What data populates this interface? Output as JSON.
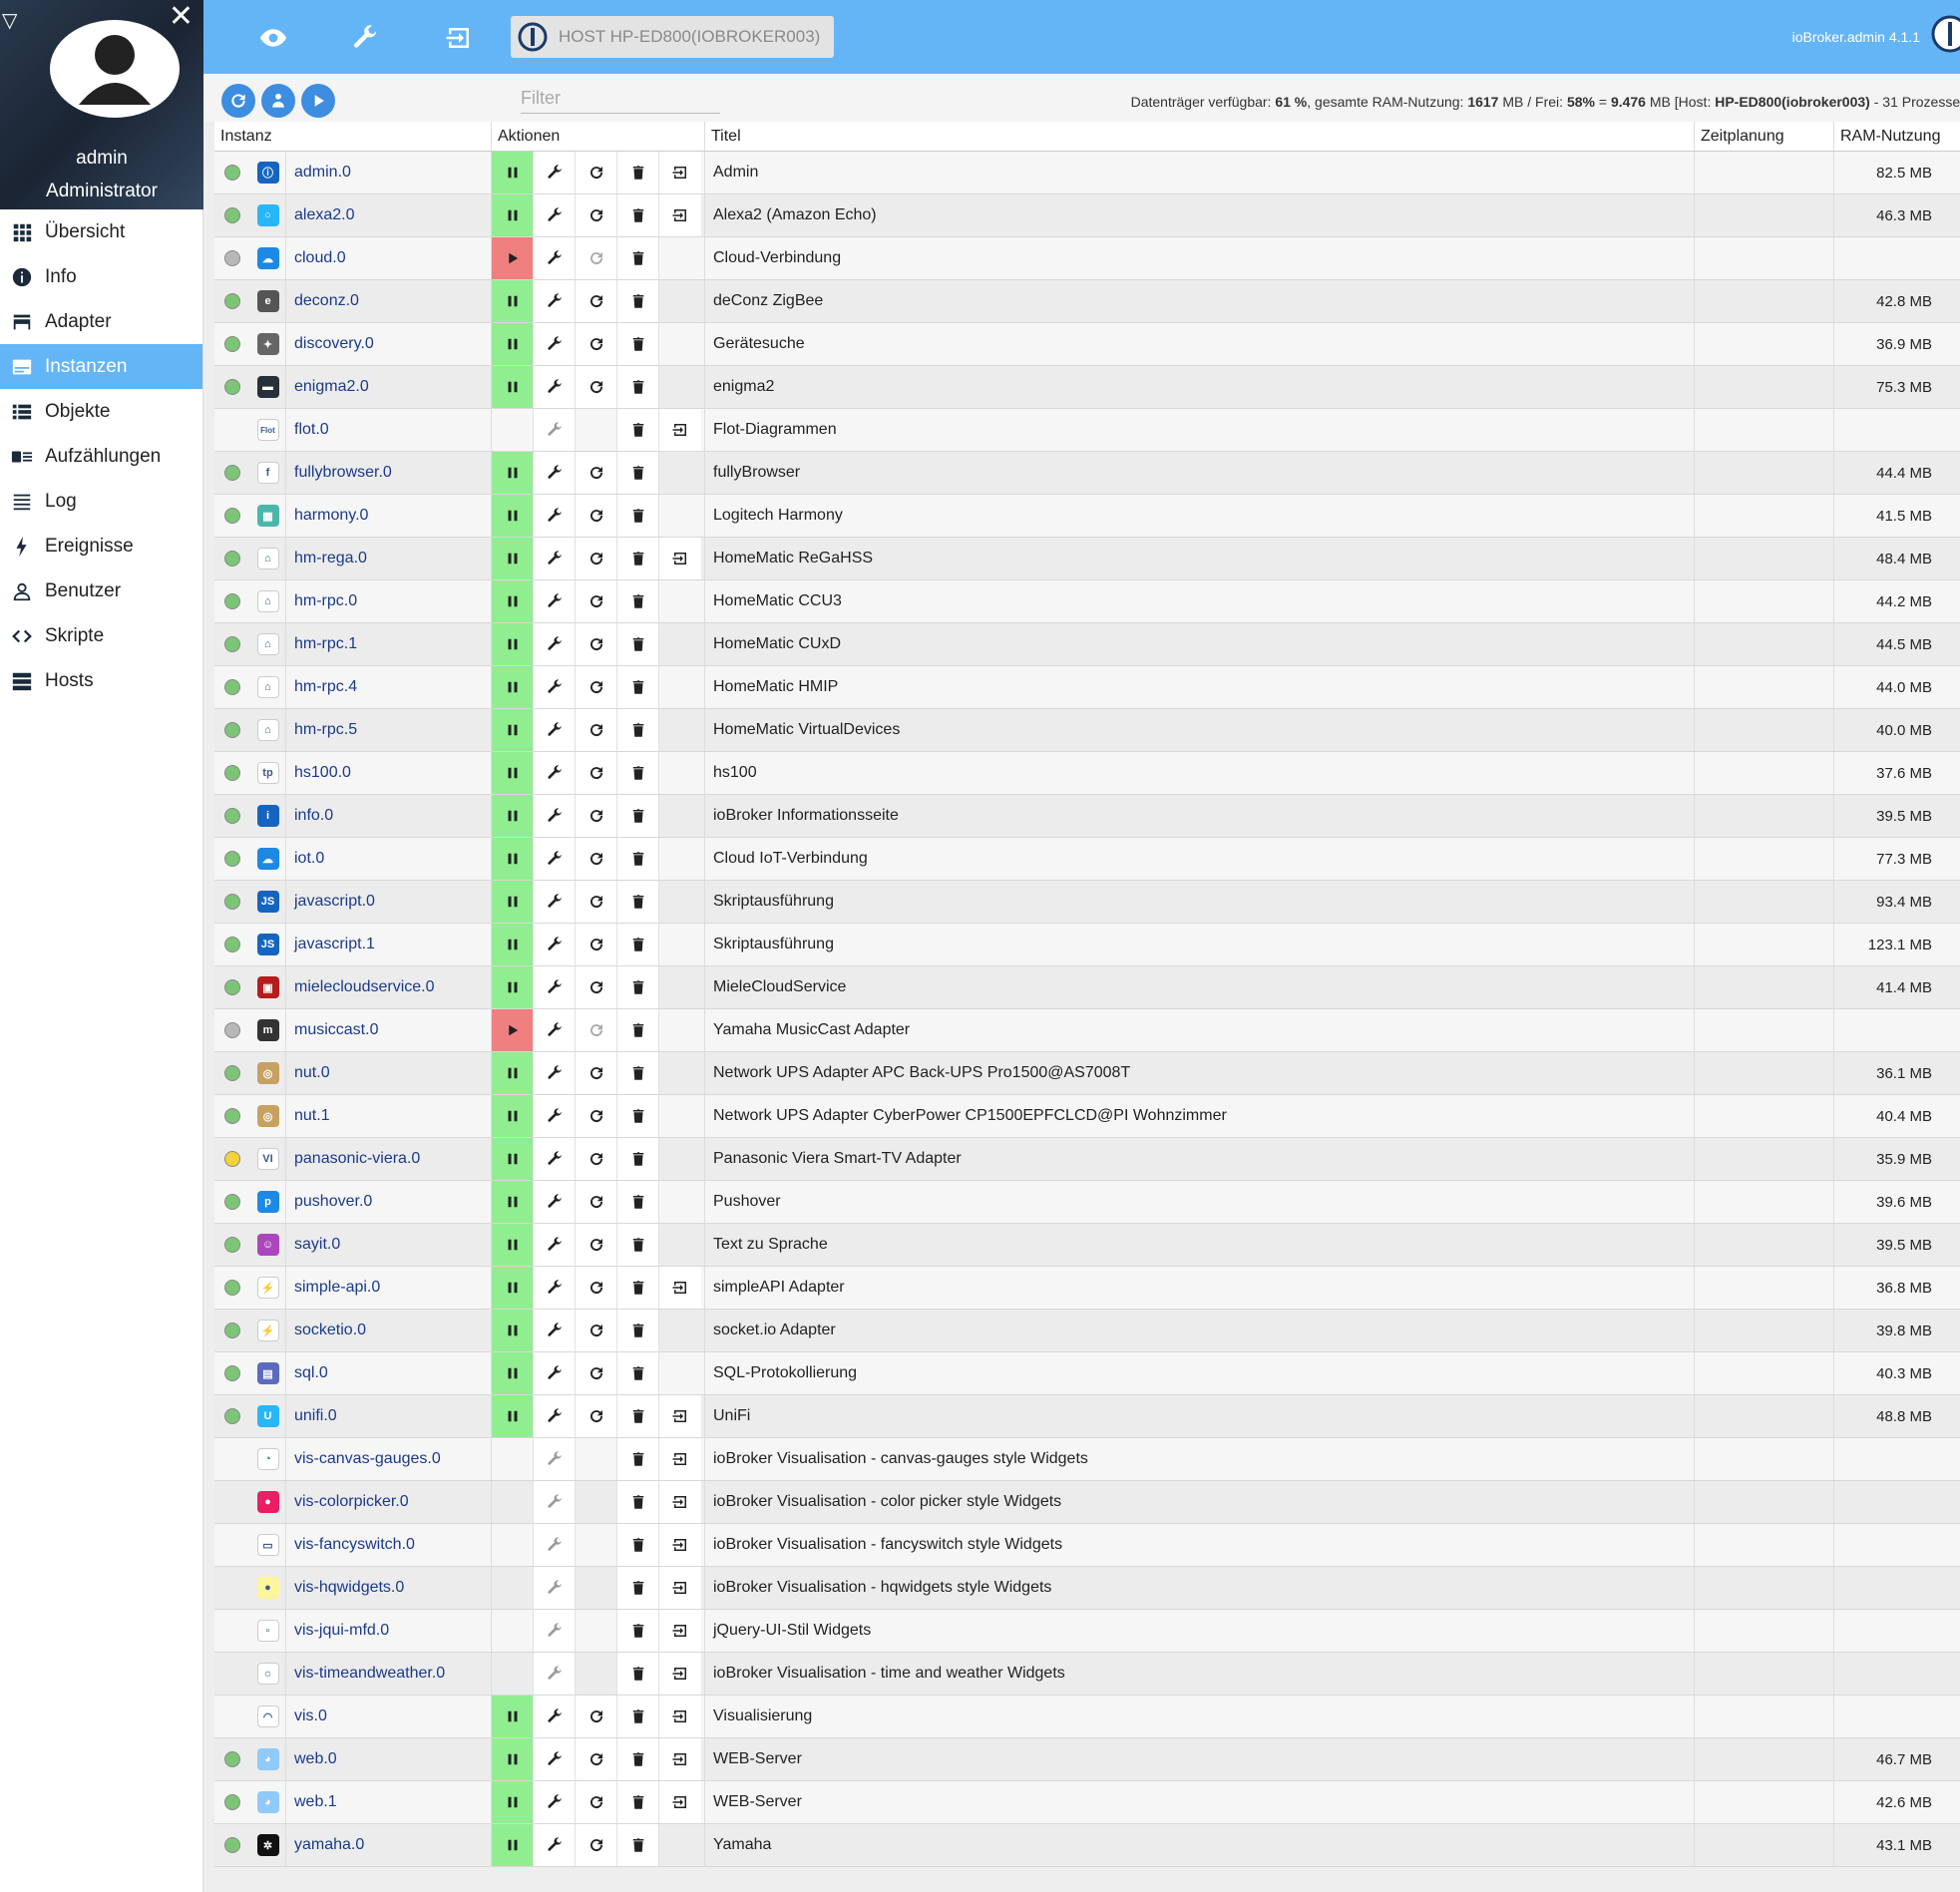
{
  "sidebar": {
    "username": "admin",
    "role": "Administrator",
    "items": [
      {
        "label": "Übersicht",
        "icon": "grid-icon"
      },
      {
        "label": "Info",
        "icon": "info-icon"
      },
      {
        "label": "Adapter",
        "icon": "store-icon"
      },
      {
        "label": "Instanzen",
        "icon": "instances-icon"
      },
      {
        "label": "Objekte",
        "icon": "list-icon"
      },
      {
        "label": "Aufzählungen",
        "icon": "enum-icon"
      },
      {
        "label": "Log",
        "icon": "log-icon"
      },
      {
        "label": "Ereignisse",
        "icon": "bolt-icon"
      },
      {
        "label": "Benutzer",
        "icon": "user-icon"
      },
      {
        "label": "Skripte",
        "icon": "code-icon"
      },
      {
        "label": "Hosts",
        "icon": "hosts-icon"
      }
    ],
    "active_item": "Instanzen"
  },
  "topbar": {
    "host": "HOST HP-ED800(IOBROKER003)",
    "version": "ioBroker.admin 4.1.1",
    "accent": "#64b5f6"
  },
  "toolbar": {
    "filter_placeholder": "Filter",
    "sysinfo_prefix": "Datenträger verfügbar: ",
    "disk_free": "61 %",
    "sysinfo_ram_label": ", gesamte RAM-Nutzung: ",
    "ram_total": "1617",
    "sysinfo_free_label": " MB / Frei: ",
    "ram_free_pct": "58%",
    "sysinfo_eq": " = ",
    "ram_free_mb": "9.476",
    "sysinfo_host_label": " MB [Host: ",
    "host_name": "HP-ED800(iobroker003)",
    "sysinfo_suffix": " - 31 Prozesse]"
  },
  "table": {
    "headers": {
      "instance": "Instanz",
      "actions": "Aktionen",
      "title": "Titel",
      "schedule": "Zeitplanung",
      "ram": "RAM-Nutzung"
    },
    "rows": [
      {
        "name": "admin.0",
        "title": "Admin",
        "ram": "82.5 MB",
        "status": "green",
        "state": "run",
        "link": true,
        "icon": "admin-icon",
        "icolor": "#1565c0",
        "glyph": "ⓘ"
      },
      {
        "name": "alexa2.0",
        "title": "Alexa2 (Amazon Echo)",
        "ram": "46.3 MB",
        "status": "green",
        "state": "run",
        "link": true,
        "icon": "alexa-icon",
        "icolor": "#29b6f6",
        "glyph": "○"
      },
      {
        "name": "cloud.0",
        "title": "Cloud-Verbindung",
        "ram": "",
        "status": "grey",
        "state": "stopped",
        "link": false,
        "icon": "cloud-icon",
        "icolor": "#1e88e5",
        "glyph": "☁"
      },
      {
        "name": "deconz.0",
        "title": "deConz ZigBee",
        "ram": "42.8 MB",
        "status": "green",
        "state": "run",
        "link": false,
        "icon": "deconz-icon",
        "icolor": "#555555",
        "glyph": "e"
      },
      {
        "name": "discovery.0",
        "title": "Gerätesuche",
        "ram": "36.9 MB",
        "status": "green",
        "state": "run",
        "link": false,
        "icon": "discovery-icon",
        "icolor": "#666666",
        "glyph": "✦"
      },
      {
        "name": "enigma2.0",
        "title": "enigma2",
        "ram": "75.3 MB",
        "status": "green",
        "state": "run",
        "link": false,
        "icon": "enigma-icon",
        "icolor": "#263238",
        "glyph": "▬"
      },
      {
        "name": "flot.0",
        "title": "Flot-Diagrammen",
        "ram": "",
        "status": "none",
        "state": "none",
        "link": true,
        "icon": "flot-icon",
        "icolor": "#ffffff",
        "glyph": "Flot"
      },
      {
        "name": "fullybrowser.0",
        "title": "fullyBrowser",
        "ram": "44.4 MB",
        "status": "green",
        "state": "run",
        "link": false,
        "icon": "fully-icon",
        "icolor": "#ffffff",
        "glyph": "f"
      },
      {
        "name": "harmony.0",
        "title": "Logitech Harmony",
        "ram": "41.5 MB",
        "status": "green",
        "state": "run",
        "link": false,
        "icon": "harmony-icon",
        "icolor": "#4db6ac",
        "glyph": "▦"
      },
      {
        "name": "hm-rega.0",
        "title": "HomeMatic ReGaHSS",
        "ram": "48.4 MB",
        "status": "green",
        "state": "run",
        "link": true,
        "icon": "homematic-icon",
        "icolor": "#ffffff",
        "glyph": "⌂"
      },
      {
        "name": "hm-rpc.0",
        "title": "HomeMatic CCU3",
        "ram": "44.2 MB",
        "status": "green",
        "state": "run",
        "link": false,
        "icon": "homematic-icon",
        "icolor": "#ffffff",
        "glyph": "⌂"
      },
      {
        "name": "hm-rpc.1",
        "title": "HomeMatic CUxD",
        "ram": "44.5 MB",
        "status": "green",
        "state": "run",
        "link": false,
        "icon": "homematic-icon",
        "icolor": "#ffffff",
        "glyph": "⌂"
      },
      {
        "name": "hm-rpc.4",
        "title": "HomeMatic HMIP",
        "ram": "44.0 MB",
        "status": "green",
        "state": "run",
        "link": false,
        "icon": "homematic-icon",
        "icolor": "#ffffff",
        "glyph": "⌂"
      },
      {
        "name": "hm-rpc.5",
        "title": "HomeMatic VirtualDevices",
        "ram": "40.0 MB",
        "status": "green",
        "state": "run",
        "link": false,
        "icon": "homematic-icon",
        "icolor": "#ffffff",
        "glyph": "⌂"
      },
      {
        "name": "hs100.0",
        "title": "hs100",
        "ram": "37.6 MB",
        "status": "green",
        "state": "run",
        "link": false,
        "icon": "tplink-icon",
        "icolor": "#ffffff",
        "glyph": "tp"
      },
      {
        "name": "info.0",
        "title": "ioBroker Informationsseite",
        "ram": "39.5 MB",
        "status": "green",
        "state": "run",
        "link": false,
        "icon": "info-adapter-icon",
        "icolor": "#1565c0",
        "glyph": "i"
      },
      {
        "name": "iot.0",
        "title": "Cloud IoT-Verbindung",
        "ram": "77.3 MB",
        "status": "green",
        "state": "run",
        "link": false,
        "icon": "iot-icon",
        "icolor": "#1e88e5",
        "glyph": "☁"
      },
      {
        "name": "javascript.0",
        "title": "Skriptausführung",
        "ram": "93.4 MB",
        "status": "green",
        "state": "run",
        "link": false,
        "icon": "js-icon",
        "icolor": "#1565c0",
        "glyph": "JS"
      },
      {
        "name": "javascript.1",
        "title": "Skriptausführung",
        "ram": "123.1 MB",
        "status": "green",
        "state": "run",
        "link": false,
        "icon": "js-icon",
        "icolor": "#1565c0",
        "glyph": "JS"
      },
      {
        "name": "mielecloudservice.0",
        "title": "MieleCloudService",
        "ram": "41.4 MB",
        "status": "green",
        "state": "run",
        "link": false,
        "icon": "miele-icon",
        "icolor": "#b71c1c",
        "glyph": "▣"
      },
      {
        "name": "musiccast.0",
        "title": "Yamaha MusicCast Adapter",
        "ram": "",
        "status": "grey",
        "state": "stopped",
        "link": false,
        "icon": "musiccast-icon",
        "icolor": "#333333",
        "glyph": "m"
      },
      {
        "name": "nut.0",
        "title": "Network UPS Adapter APC Back-UPS Pro1500@AS7008T",
        "ram": "36.1 MB",
        "status": "green",
        "state": "run",
        "link": false,
        "icon": "nut-icon",
        "icolor": "#c8a060",
        "glyph": "◎"
      },
      {
        "name": "nut.1",
        "title": "Network UPS Adapter CyberPower CP1500EPFCLCD@PI Wohnzimmer",
        "ram": "40.4 MB",
        "status": "green",
        "state": "run",
        "link": false,
        "icon": "nut-icon",
        "icolor": "#c8a060",
        "glyph": "◎"
      },
      {
        "name": "panasonic-viera.0",
        "title": "Panasonic Viera Smart-TV Adapter",
        "ram": "35.9 MB",
        "status": "yellow",
        "state": "run",
        "link": false,
        "icon": "viera-icon",
        "icolor": "#ffffff",
        "glyph": "VI"
      },
      {
        "name": "pushover.0",
        "title": "Pushover",
        "ram": "39.6 MB",
        "status": "green",
        "state": "run",
        "link": false,
        "icon": "pushover-icon",
        "icolor": "#1e88e5",
        "glyph": "p"
      },
      {
        "name": "sayit.0",
        "title": "Text zu Sprache",
        "ram": "39.5 MB",
        "status": "green",
        "state": "run",
        "link": false,
        "icon": "sayit-icon",
        "icolor": "#ab47bc",
        "glyph": "☺"
      },
      {
        "name": "simple-api.0",
        "title": "simpleAPI Adapter",
        "ram": "36.8 MB",
        "status": "green",
        "state": "run",
        "link": true,
        "icon": "simpleapi-icon",
        "icolor": "#ffffff",
        "glyph": "⚡"
      },
      {
        "name": "socketio.0",
        "title": "socket.io Adapter",
        "ram": "39.8 MB",
        "status": "green",
        "state": "run",
        "link": false,
        "icon": "socketio-icon",
        "icolor": "#ffffff",
        "glyph": "⚡"
      },
      {
        "name": "sql.0",
        "title": "SQL-Protokollierung",
        "ram": "40.3 MB",
        "status": "green",
        "state": "run",
        "link": false,
        "icon": "sql-icon",
        "icolor": "#5c6bc0",
        "glyph": "▤"
      },
      {
        "name": "unifi.0",
        "title": "UniFi",
        "ram": "48.8 MB",
        "status": "green",
        "state": "run",
        "link": true,
        "icon": "unifi-icon",
        "icolor": "#29b6f6",
        "glyph": "U"
      },
      {
        "name": "vis-canvas-gauges.0",
        "title": "ioBroker Visualisation - canvas-gauges style Widgets",
        "ram": "",
        "status": "none",
        "state": "none",
        "link": true,
        "icon": "gauge-icon",
        "icolor": "#ffffff",
        "glyph": "◔"
      },
      {
        "name": "vis-colorpicker.0",
        "title": "ioBroker Visualisation - color picker style Widgets",
        "ram": "",
        "status": "none",
        "state": "none",
        "link": true,
        "icon": "colorpicker-icon",
        "icolor": "#e91e63",
        "glyph": "●"
      },
      {
        "name": "vis-fancyswitch.0",
        "title": "ioBroker Visualisation - fancyswitch style Widgets",
        "ram": "",
        "status": "none",
        "state": "none",
        "link": true,
        "icon": "switch-icon",
        "icolor": "#ffffff",
        "glyph": "▭"
      },
      {
        "name": "vis-hqwidgets.0",
        "title": "ioBroker Visualisation - hqwidgets style Widgets",
        "ram": "",
        "status": "none",
        "state": "none",
        "link": true,
        "icon": "bulb-icon",
        "icolor": "#fff59d",
        "glyph": "●"
      },
      {
        "name": "vis-jqui-mfd.0",
        "title": "jQuery-UI-Stil Widgets",
        "ram": "",
        "status": "none",
        "state": "none",
        "link": true,
        "icon": "jqui-icon",
        "icolor": "#ffffff",
        "glyph": "▫"
      },
      {
        "name": "vis-timeandweather.0",
        "title": "ioBroker Visualisation - time and weather Widgets",
        "ram": "",
        "status": "none",
        "state": "none",
        "link": true,
        "icon": "weather-icon",
        "icolor": "#ffffff",
        "glyph": "☼"
      },
      {
        "name": "vis.0",
        "title": "Visualisierung",
        "ram": "",
        "status": "none",
        "state": "run",
        "link": true,
        "icon": "vis-icon",
        "icolor": "#ffffff",
        "glyph": "◠"
      },
      {
        "name": "web.0",
        "title": "WEB-Server",
        "ram": "46.7 MB",
        "status": "green",
        "state": "run",
        "link": true,
        "icon": "web-icon",
        "icolor": "#90caf9",
        "glyph": "◕"
      },
      {
        "name": "web.1",
        "title": "WEB-Server",
        "ram": "42.6 MB",
        "status": "green",
        "state": "run",
        "link": true,
        "icon": "web-icon",
        "icolor": "#90caf9",
        "glyph": "◕"
      },
      {
        "name": "yamaha.0",
        "title": "Yamaha",
        "ram": "43.1 MB",
        "status": "green",
        "state": "run",
        "link": false,
        "icon": "yamaha-icon",
        "icolor": "#111111",
        "glyph": "✲"
      }
    ]
  }
}
